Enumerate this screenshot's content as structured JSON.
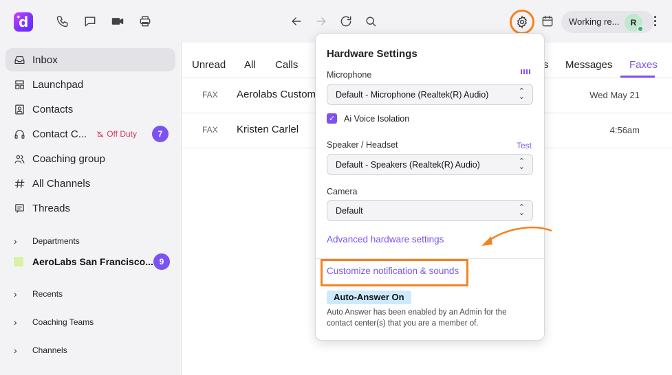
{
  "app": {
    "logo_letter": "d",
    "brand_color": "#7c52f0",
    "highlight_color": "#f58220"
  },
  "toolbar": {
    "icons": [
      "phone-icon",
      "chat-icon",
      "video-icon",
      "printer-icon"
    ],
    "nav_icons": [
      "back-arrow-icon",
      "forward-arrow-icon",
      "refresh-icon",
      "search-icon"
    ],
    "right_icons": [
      "gear-icon",
      "calendar-icon",
      "more-vertical-icon"
    ]
  },
  "status": {
    "label": "Working re...",
    "avatar_initial": "R",
    "online_color": "#2bb673"
  },
  "sidebar": {
    "items": [
      {
        "label": "Inbox",
        "icon": "inbox-icon",
        "active": true
      },
      {
        "label": "Launchpad",
        "icon": "launchpad-icon"
      },
      {
        "label": "Contacts",
        "icon": "contacts-icon"
      },
      {
        "label": "Contact C...",
        "icon": "headset-icon",
        "status": "Off Duty",
        "badge": "7"
      },
      {
        "label": "Coaching group",
        "icon": "people-icon"
      },
      {
        "label": "All Channels",
        "icon": "hash-icon"
      },
      {
        "label": "Threads",
        "icon": "threads-icon"
      }
    ],
    "departments_label": "Departments",
    "department_group": {
      "label": "AeroLabs San Francisco...",
      "badge": "9"
    },
    "sections": [
      "Recents",
      "Coaching Teams",
      "Channels"
    ]
  },
  "main": {
    "tabs": [
      "Unread",
      "All",
      "Calls",
      "s",
      "Messages",
      "Faxes"
    ],
    "active_tab": "Faxes",
    "rows": [
      {
        "type": "FAX",
        "name": "Aerolabs Custome",
        "time": "Wed May 21"
      },
      {
        "type": "FAX",
        "name": "Kristen Carlel",
        "time": "4:56am"
      }
    ]
  },
  "hardware": {
    "title": "Hardware Settings",
    "microphone_label": "Microphone",
    "microphone_value": "Default - Microphone (Realtek(R) Audio)",
    "voice_isolation_label": "Ai Voice Isolation",
    "voice_isolation_checked": true,
    "speaker_label": "Speaker / Headset",
    "test_label": "Test",
    "speaker_value": "Default - Speakers (Realtek(R) Audio)",
    "camera_label": "Camera",
    "camera_value": "Default",
    "advanced_link": "Advanced hardware settings",
    "customize_link": "Customize notification & sounds",
    "auto_answer_badge": "Auto-Answer On",
    "auto_answer_text": "Auto Answer has been enabled by an Admin for the contact center(s) that you are a member of."
  }
}
